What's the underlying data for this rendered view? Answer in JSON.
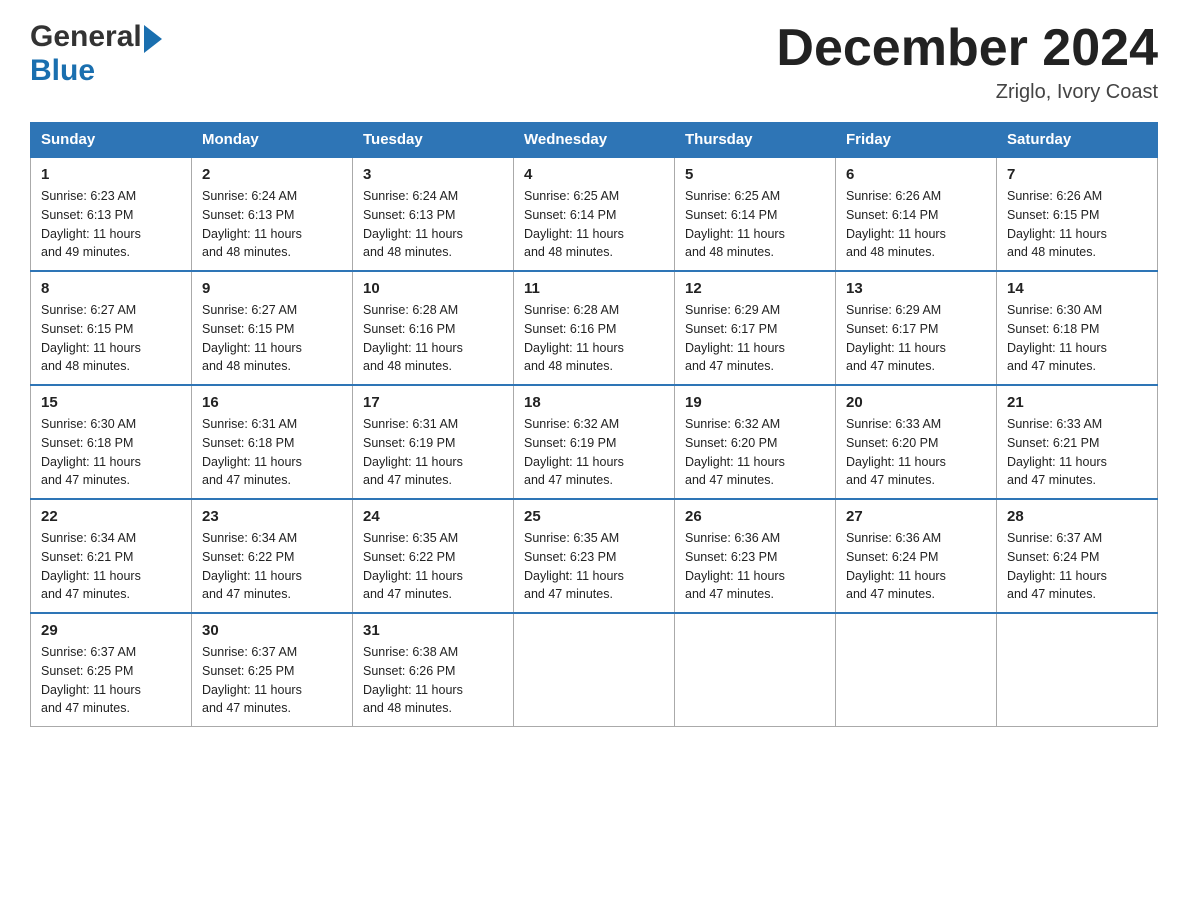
{
  "header": {
    "title": "December 2024",
    "location": "Zriglo, Ivory Coast"
  },
  "logo": {
    "general": "General",
    "blue": "Blue"
  },
  "weekdays": [
    "Sunday",
    "Monday",
    "Tuesday",
    "Wednesday",
    "Thursday",
    "Friday",
    "Saturday"
  ],
  "weeks": [
    [
      {
        "day": "1",
        "sunrise": "6:23 AM",
        "sunset": "6:13 PM",
        "daylight": "11 hours and 49 minutes."
      },
      {
        "day": "2",
        "sunrise": "6:24 AM",
        "sunset": "6:13 PM",
        "daylight": "11 hours and 48 minutes."
      },
      {
        "day": "3",
        "sunrise": "6:24 AM",
        "sunset": "6:13 PM",
        "daylight": "11 hours and 48 minutes."
      },
      {
        "day": "4",
        "sunrise": "6:25 AM",
        "sunset": "6:14 PM",
        "daylight": "11 hours and 48 minutes."
      },
      {
        "day": "5",
        "sunrise": "6:25 AM",
        "sunset": "6:14 PM",
        "daylight": "11 hours and 48 minutes."
      },
      {
        "day": "6",
        "sunrise": "6:26 AM",
        "sunset": "6:14 PM",
        "daylight": "11 hours and 48 minutes."
      },
      {
        "day": "7",
        "sunrise": "6:26 AM",
        "sunset": "6:15 PM",
        "daylight": "11 hours and 48 minutes."
      }
    ],
    [
      {
        "day": "8",
        "sunrise": "6:27 AM",
        "sunset": "6:15 PM",
        "daylight": "11 hours and 48 minutes."
      },
      {
        "day": "9",
        "sunrise": "6:27 AM",
        "sunset": "6:15 PM",
        "daylight": "11 hours and 48 minutes."
      },
      {
        "day": "10",
        "sunrise": "6:28 AM",
        "sunset": "6:16 PM",
        "daylight": "11 hours and 48 minutes."
      },
      {
        "day": "11",
        "sunrise": "6:28 AM",
        "sunset": "6:16 PM",
        "daylight": "11 hours and 48 minutes."
      },
      {
        "day": "12",
        "sunrise": "6:29 AM",
        "sunset": "6:17 PM",
        "daylight": "11 hours and 47 minutes."
      },
      {
        "day": "13",
        "sunrise": "6:29 AM",
        "sunset": "6:17 PM",
        "daylight": "11 hours and 47 minutes."
      },
      {
        "day": "14",
        "sunrise": "6:30 AM",
        "sunset": "6:18 PM",
        "daylight": "11 hours and 47 minutes."
      }
    ],
    [
      {
        "day": "15",
        "sunrise": "6:30 AM",
        "sunset": "6:18 PM",
        "daylight": "11 hours and 47 minutes."
      },
      {
        "day": "16",
        "sunrise": "6:31 AM",
        "sunset": "6:18 PM",
        "daylight": "11 hours and 47 minutes."
      },
      {
        "day": "17",
        "sunrise": "6:31 AM",
        "sunset": "6:19 PM",
        "daylight": "11 hours and 47 minutes."
      },
      {
        "day": "18",
        "sunrise": "6:32 AM",
        "sunset": "6:19 PM",
        "daylight": "11 hours and 47 minutes."
      },
      {
        "day": "19",
        "sunrise": "6:32 AM",
        "sunset": "6:20 PM",
        "daylight": "11 hours and 47 minutes."
      },
      {
        "day": "20",
        "sunrise": "6:33 AM",
        "sunset": "6:20 PM",
        "daylight": "11 hours and 47 minutes."
      },
      {
        "day": "21",
        "sunrise": "6:33 AM",
        "sunset": "6:21 PM",
        "daylight": "11 hours and 47 minutes."
      }
    ],
    [
      {
        "day": "22",
        "sunrise": "6:34 AM",
        "sunset": "6:21 PM",
        "daylight": "11 hours and 47 minutes."
      },
      {
        "day": "23",
        "sunrise": "6:34 AM",
        "sunset": "6:22 PM",
        "daylight": "11 hours and 47 minutes."
      },
      {
        "day": "24",
        "sunrise": "6:35 AM",
        "sunset": "6:22 PM",
        "daylight": "11 hours and 47 minutes."
      },
      {
        "day": "25",
        "sunrise": "6:35 AM",
        "sunset": "6:23 PM",
        "daylight": "11 hours and 47 minutes."
      },
      {
        "day": "26",
        "sunrise": "6:36 AM",
        "sunset": "6:23 PM",
        "daylight": "11 hours and 47 minutes."
      },
      {
        "day": "27",
        "sunrise": "6:36 AM",
        "sunset": "6:24 PM",
        "daylight": "11 hours and 47 minutes."
      },
      {
        "day": "28",
        "sunrise": "6:37 AM",
        "sunset": "6:24 PM",
        "daylight": "11 hours and 47 minutes."
      }
    ],
    [
      {
        "day": "29",
        "sunrise": "6:37 AM",
        "sunset": "6:25 PM",
        "daylight": "11 hours and 47 minutes."
      },
      {
        "day": "30",
        "sunrise": "6:37 AM",
        "sunset": "6:25 PM",
        "daylight": "11 hours and 47 minutes."
      },
      {
        "day": "31",
        "sunrise": "6:38 AM",
        "sunset": "6:26 PM",
        "daylight": "11 hours and 48 minutes."
      },
      null,
      null,
      null,
      null
    ]
  ],
  "labels": {
    "sunrise": "Sunrise: ",
    "sunset": "Sunset: ",
    "daylight": "Daylight: "
  }
}
